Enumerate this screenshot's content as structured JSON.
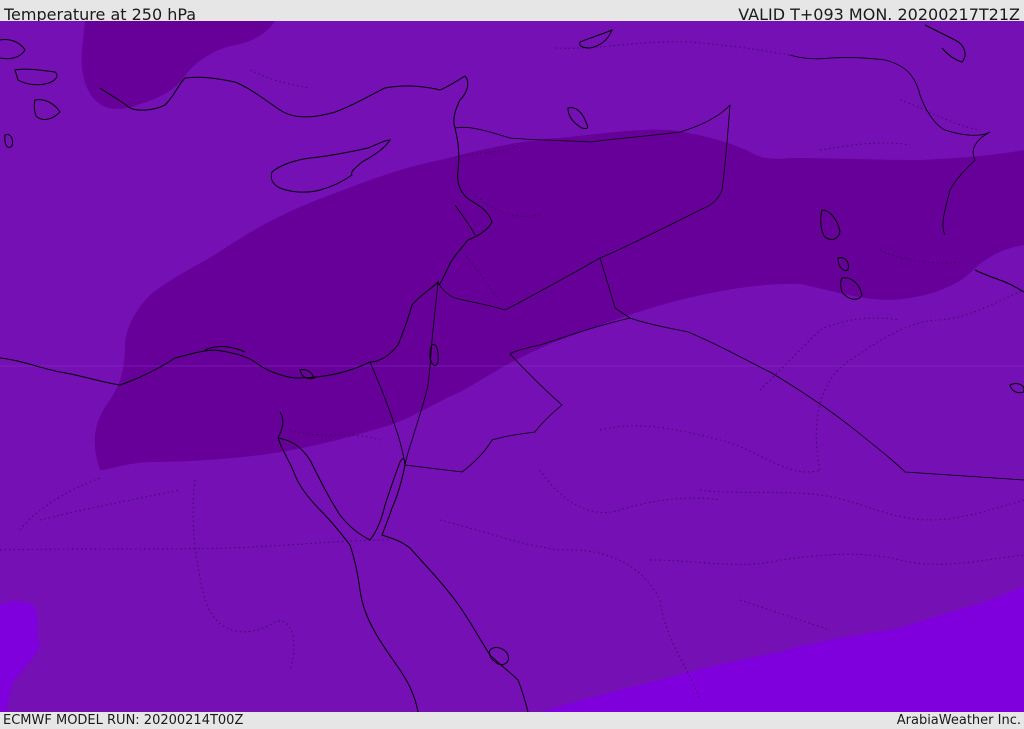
{
  "header": {
    "title": "Temperature at 250 hPa",
    "valid_time": "VALID T+093 MON. 20200217T21Z"
  },
  "footer": {
    "model_run": "ECMWF MODEL RUN: 20200214T00Z",
    "credit": "ArabiaWeather Inc."
  },
  "map": {
    "field_colors": {
      "base": "#7510b4",
      "cold_band": "#660099",
      "warm_region": "#7f00dd"
    }
  }
}
